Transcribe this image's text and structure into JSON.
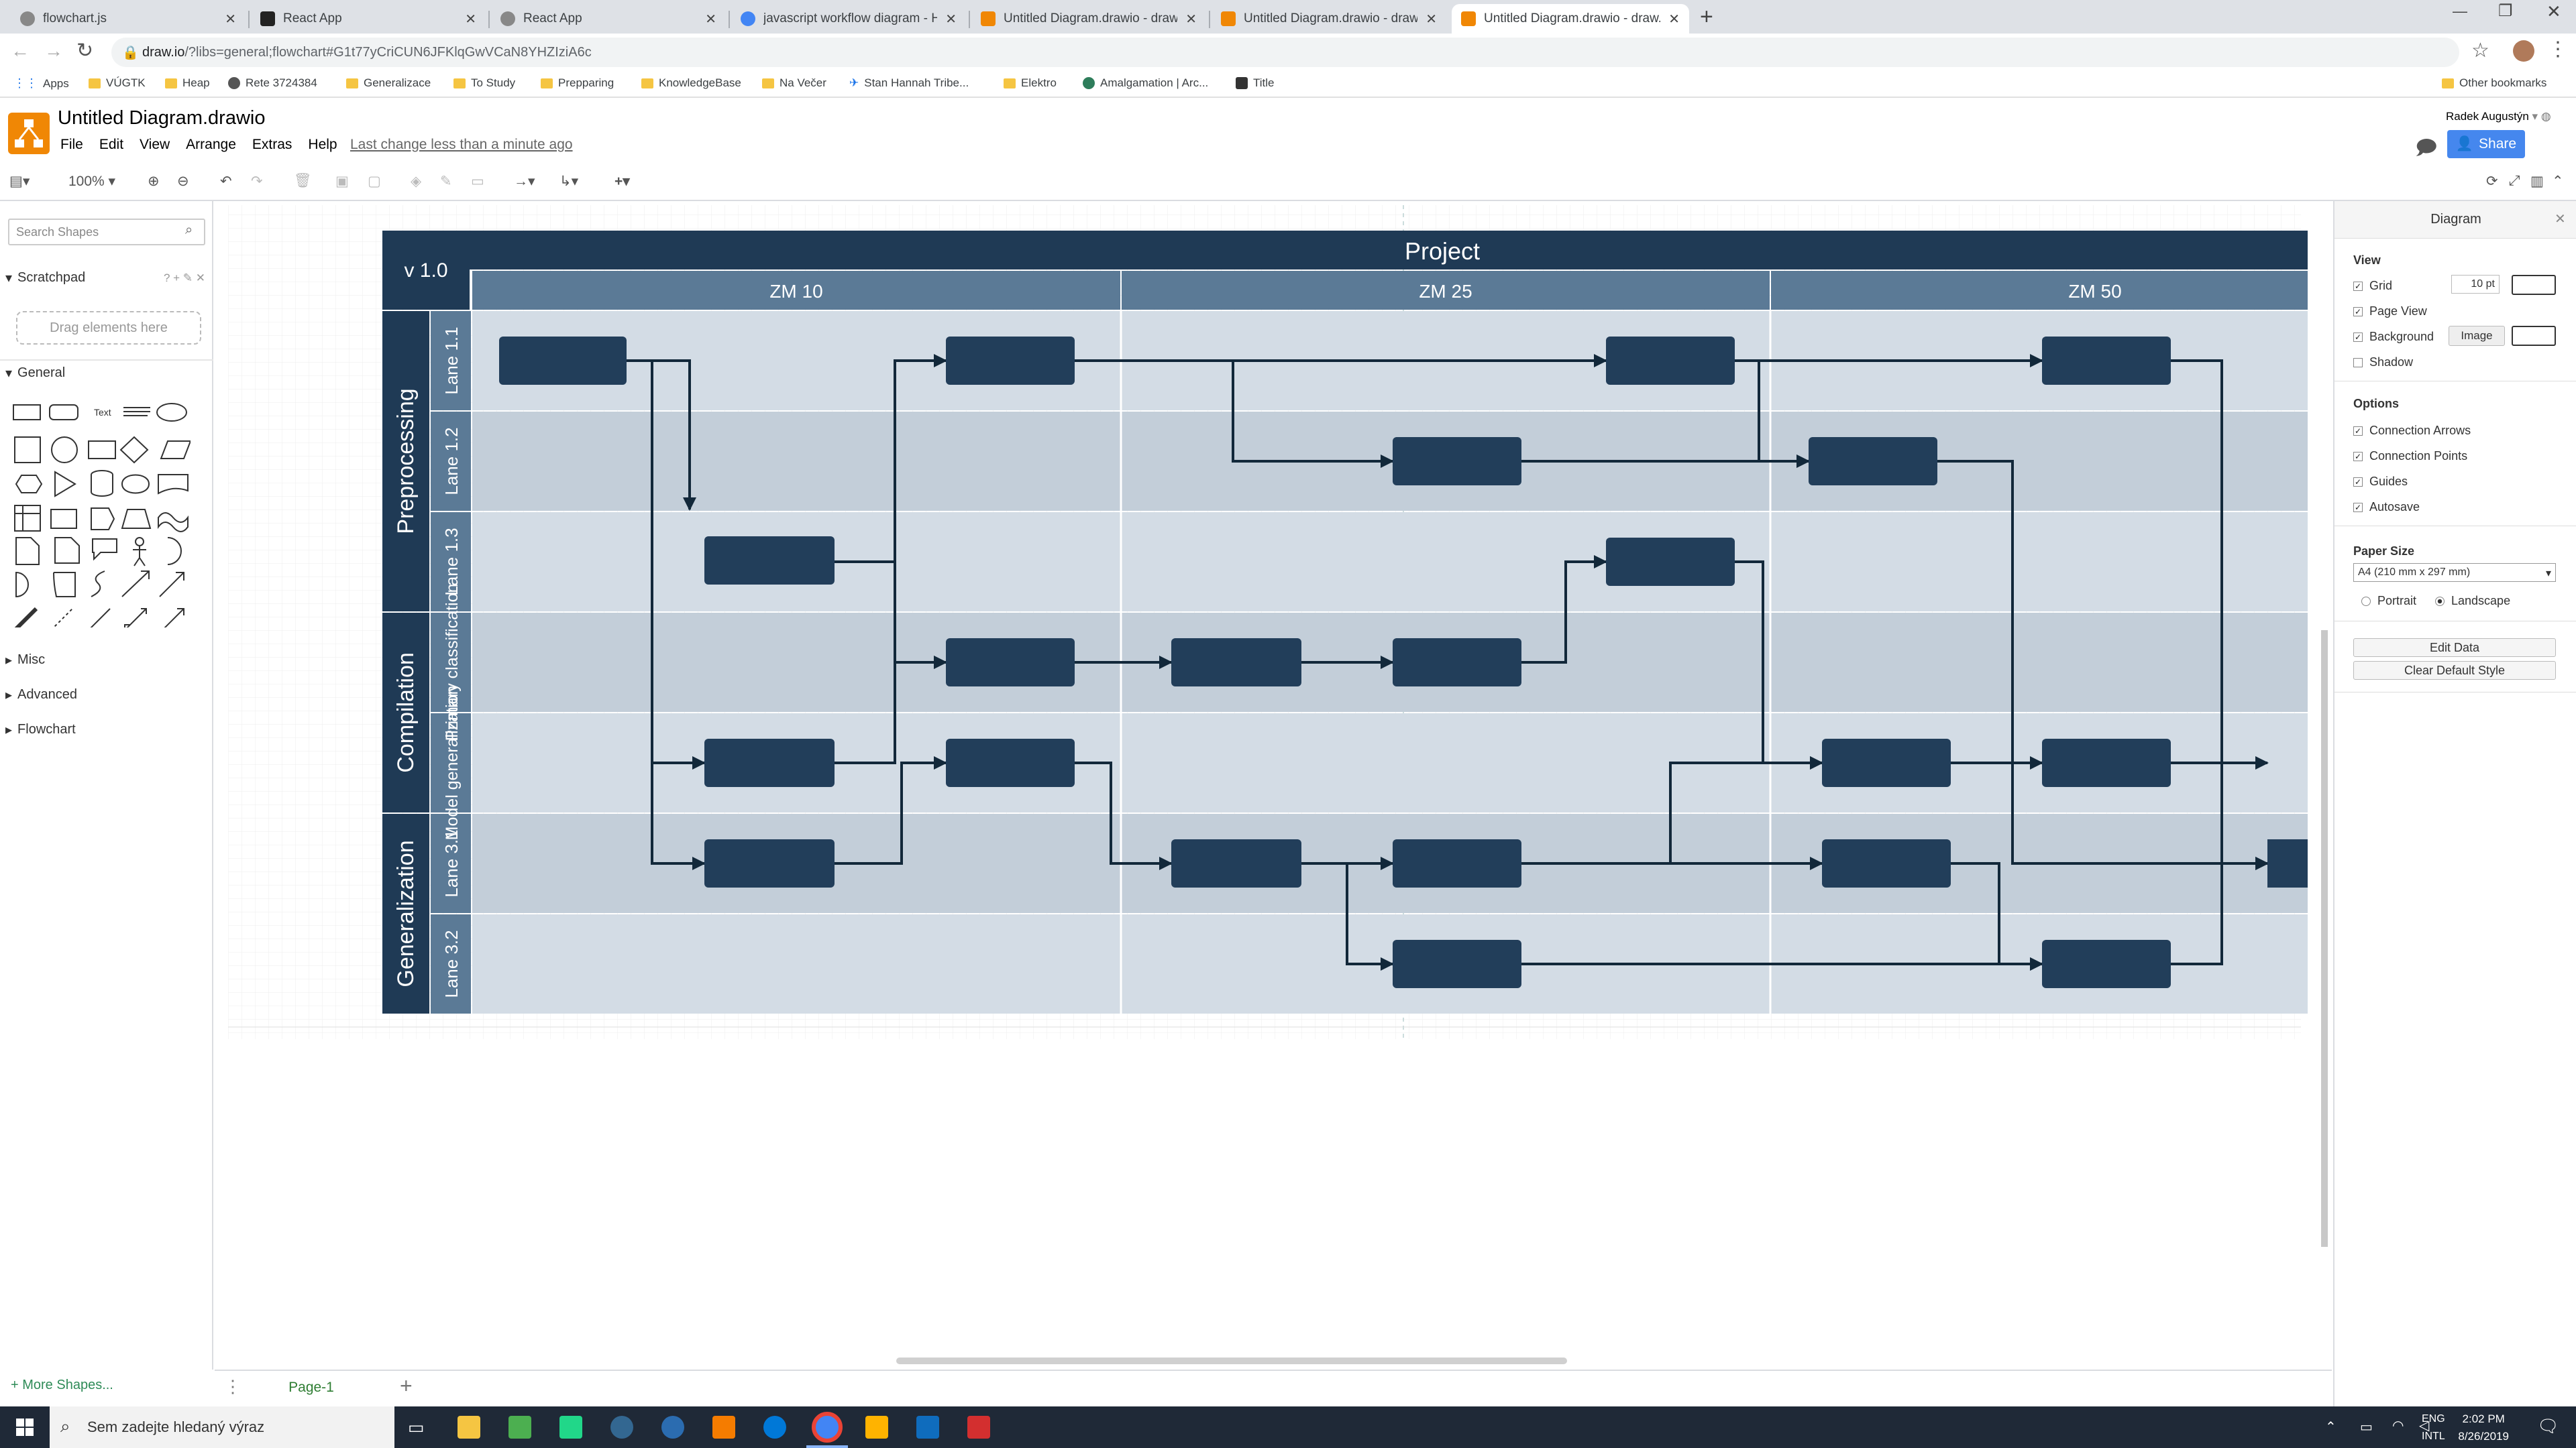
{
  "browser": {
    "tabs": [
      {
        "title": "flowchart.js"
      },
      {
        "title": "React App"
      },
      {
        "title": "React App"
      },
      {
        "title": "javascript workflow diagram - Hi"
      },
      {
        "title": "Untitled Diagram.drawio - draw.i"
      },
      {
        "title": "Untitled Diagram.drawio - draw.i"
      },
      {
        "title": "Untitled Diagram.drawio - draw.i"
      }
    ],
    "url_host": "draw.io",
    "url_rest": "/?libs=general;flowchart#G1t77yCriCUN6JFKlqGwVCaN8YHZIziA6c",
    "bookmarks": [
      "Apps",
      "VÚGTK",
      "Heap",
      "Rete 3724384",
      "Generalizace",
      "To Study",
      "Prepparing",
      "KnowledgeBase",
      "Na Večer",
      "Stan Hannah Tribe...",
      "Elektro",
      "Amalgamation | Arc...",
      "Title"
    ],
    "other_bookmarks": "Other bookmarks"
  },
  "app": {
    "doc_title": "Untitled Diagram.drawio",
    "menus": [
      "File",
      "Edit",
      "View",
      "Arrange",
      "Extras",
      "Help"
    ],
    "last_change": "Last change less than a minute ago",
    "user": "Radek Augustýn",
    "share_label": "Share",
    "zoom": "100%"
  },
  "sidebar": {
    "search_placeholder": "Search Shapes",
    "scratchpad": "Scratchpad",
    "scratchpad_controls": "? + ✎ ✕",
    "drag_here": "Drag elements here",
    "sections": [
      "General",
      "Misc",
      "Advanced",
      "Flowchart"
    ],
    "more_shapes": "+ More Shapes..."
  },
  "diagram": {
    "version": "v 1.0",
    "title": "Project",
    "columns": [
      "ZM 10",
      "ZM 25",
      "ZM 50"
    ],
    "groups": [
      "Preprocessing",
      "Compilation",
      "Generalization"
    ],
    "lanes": [
      "Lane 1.1",
      "Lane 1.2",
      "Lane 1.3",
      "Primary classification",
      "Model generalization",
      "Lane 3.1",
      "Lane 3.2"
    ],
    "colors": {
      "header": "#1f3a55",
      "subheader": "#5b7a96",
      "lane_dark": "#c3ced9",
      "lane_light": "#d3dce5",
      "box": "#223e5a",
      "edge": "#12283a"
    }
  },
  "pages": {
    "current": "Page-1"
  },
  "format_panel": {
    "title": "Diagram",
    "view_heading": "View",
    "grid_label": "Grid",
    "grid_size": "10 pt",
    "page_view_label": "Page View",
    "background_label": "Background",
    "image_button": "Image",
    "shadow_label": "Shadow",
    "options_heading": "Options",
    "options": [
      "Connection Arrows",
      "Connection Points",
      "Guides",
      "Autosave"
    ],
    "paper_heading": "Paper Size",
    "paper_value": "A4 (210 mm x 297 mm)",
    "portrait": "Portrait",
    "landscape": "Landscape",
    "edit_data": "Edit Data",
    "clear_style": "Clear Default Style"
  },
  "taskbar": {
    "search_placeholder": "Sem zadejte hledaný výraz",
    "lang": "ENG",
    "lang2": "INTL",
    "time": "2:02 PM",
    "date": "8/26/2019"
  }
}
